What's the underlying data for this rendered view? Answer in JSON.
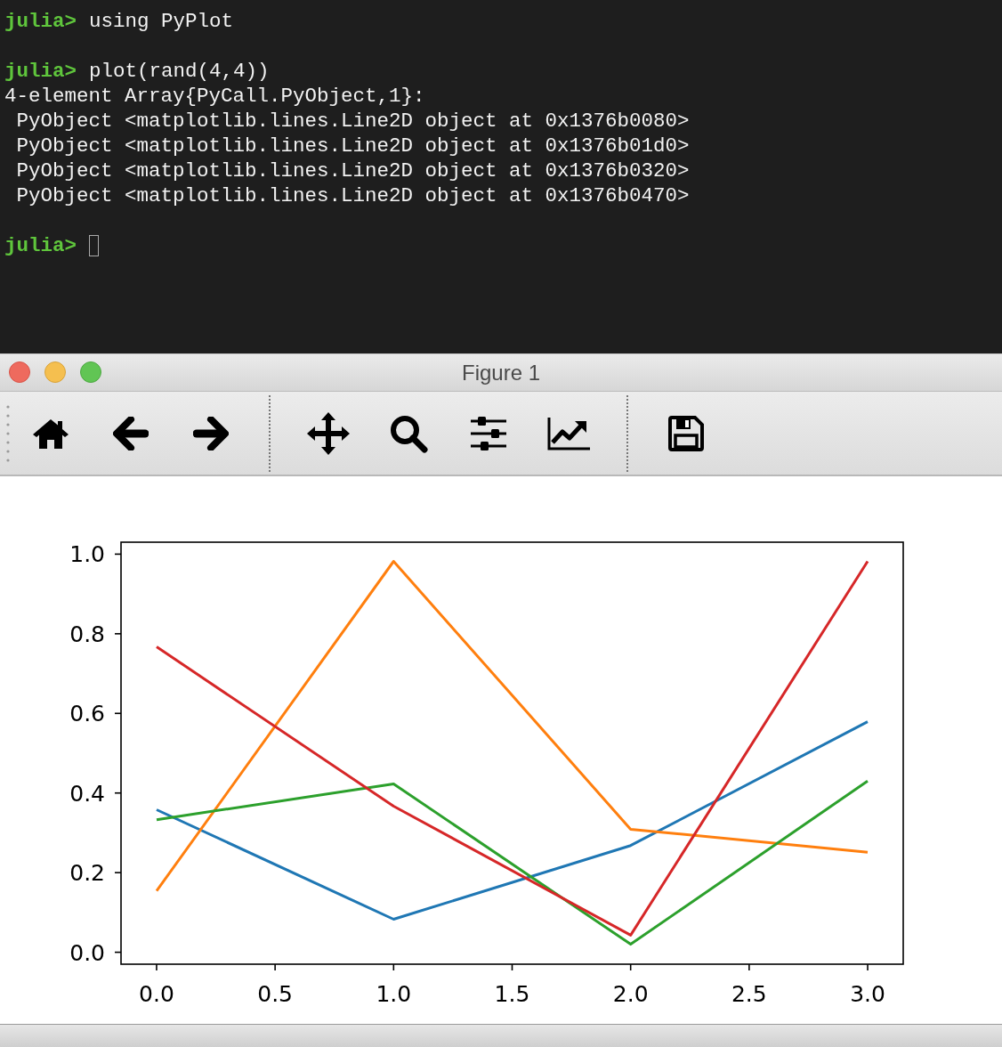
{
  "terminal": {
    "lines": [
      {
        "kind": "prompt",
        "prompt": "julia>",
        "text": "using PyPlot",
        "cursor": false
      },
      {
        "kind": "prompt",
        "prompt": "julia>",
        "text": "plot(rand(4,4))",
        "cursor": false
      },
      {
        "kind": "output",
        "text": "4-element Array{PyCall.PyObject,1}:"
      },
      {
        "kind": "output",
        "text": " PyObject <matplotlib.lines.Line2D object at 0x1376b0080>"
      },
      {
        "kind": "output",
        "text": " PyObject <matplotlib.lines.Line2D object at 0x1376b01d0>"
      },
      {
        "kind": "output",
        "text": " PyObject <matplotlib.lines.Line2D object at 0x1376b0320>"
      },
      {
        "kind": "output",
        "text": " PyObject <matplotlib.lines.Line2D object at 0x1376b0470>"
      },
      {
        "kind": "prompt",
        "prompt": "julia>",
        "cursor": true
      }
    ]
  },
  "figure_window": {
    "title": "Figure 1",
    "toolbar": [
      {
        "kind": "home"
      },
      {
        "kind": "back"
      },
      {
        "kind": "forward"
      },
      {
        "kind": "separator"
      },
      {
        "kind": "pan"
      },
      {
        "kind": "zoom"
      },
      {
        "kind": "configure"
      },
      {
        "kind": "edit"
      },
      {
        "kind": "separator"
      },
      {
        "kind": "save"
      }
    ],
    "chart_data": {
      "type": "line",
      "x": [
        0,
        1,
        2,
        3
      ],
      "series": [
        {
          "color": "#1f77b4",
          "values": [
            0.358,
            0.083,
            0.268,
            0.579
          ]
        },
        {
          "color": "#ff7f0e",
          "values": [
            0.154,
            0.982,
            0.309,
            0.251
          ]
        },
        {
          "color": "#2ca02c",
          "values": [
            0.333,
            0.423,
            0.02,
            0.43
          ]
        },
        {
          "color": "#d62728",
          "values": [
            0.767,
            0.367,
            0.043,
            0.982
          ]
        }
      ],
      "xlim": [
        -0.15,
        3.15
      ],
      "ylim": [
        -0.03,
        1.03
      ],
      "xticks": [
        {
          "value": 0,
          "label": "0.0"
        },
        {
          "value": 0.5,
          "label": "0.5"
        },
        {
          "value": 1,
          "label": "1.0"
        },
        {
          "value": 1.5,
          "label": "1.5"
        },
        {
          "value": 2,
          "label": "2.0"
        },
        {
          "value": 2.5,
          "label": "2.5"
        },
        {
          "value": 3,
          "label": "3.0"
        }
      ],
      "yticks": [
        {
          "value": 0,
          "label": "0.0"
        },
        {
          "value": 0.2,
          "label": "0.2"
        },
        {
          "value": 0.4,
          "label": "0.4"
        },
        {
          "value": 0.6,
          "label": "0.6"
        },
        {
          "value": 0.8,
          "label": "0.8"
        },
        {
          "value": 1,
          "label": "1.0"
        }
      ]
    }
  }
}
